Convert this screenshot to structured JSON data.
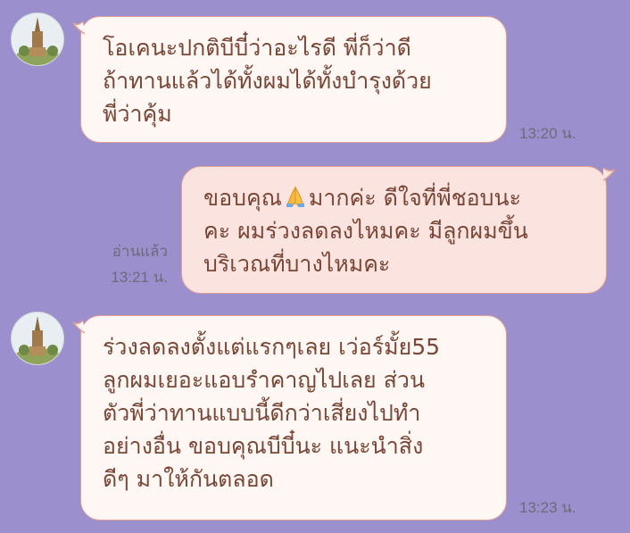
{
  "chat": {
    "messages": [
      {
        "side": "incoming",
        "lines": [
          "โอเคนะปกติบีบี๋ว่าอะไรดี พี่ก็ว่าดี",
          "ถ้าทานแล้วได้ทั้งผมได้ทั้งบำรุงด้วย",
          "พี่ว่าคุ้ม"
        ],
        "time": "13:20 น."
      },
      {
        "side": "outgoing",
        "line1_before": "ขอบคุณ",
        "emoji": "folded-hands",
        "line1_after": "มากค่ะ  ดีใจที่พี่ชอบนะ",
        "lines": [
          "คะ ผมร่วงลดลงไหมคะ มีลูกผมขึ้น",
          "บริเวณที่บางไหมคะ"
        ],
        "read_label": "อ่านแล้ว",
        "time": "13:21 น."
      },
      {
        "side": "incoming",
        "lines": [
          "ร่วงลดลงตั้งแต่แรกๆเลย เว่อร์มั้ย55",
          "ลูกผมเยอะแอบรำคาญไปเลย ส่วน",
          "ตัวพี่ว่าทานแบบนี้ดีกว่าเสี่ยงไปทำ",
          "อย่างอื่น ขอบคุณบีบี๋นะ แนะนำสิ่ง",
          "ดีๆ มาให้กันตลอด"
        ],
        "time": "13:23 น."
      }
    ]
  },
  "colors": {
    "background": "#9b8fce",
    "incoming_bubble": "#fff7f3",
    "outgoing_bubble": "#fbe3df",
    "bubble_border": "#e3a093",
    "text": "#7a4636"
  }
}
